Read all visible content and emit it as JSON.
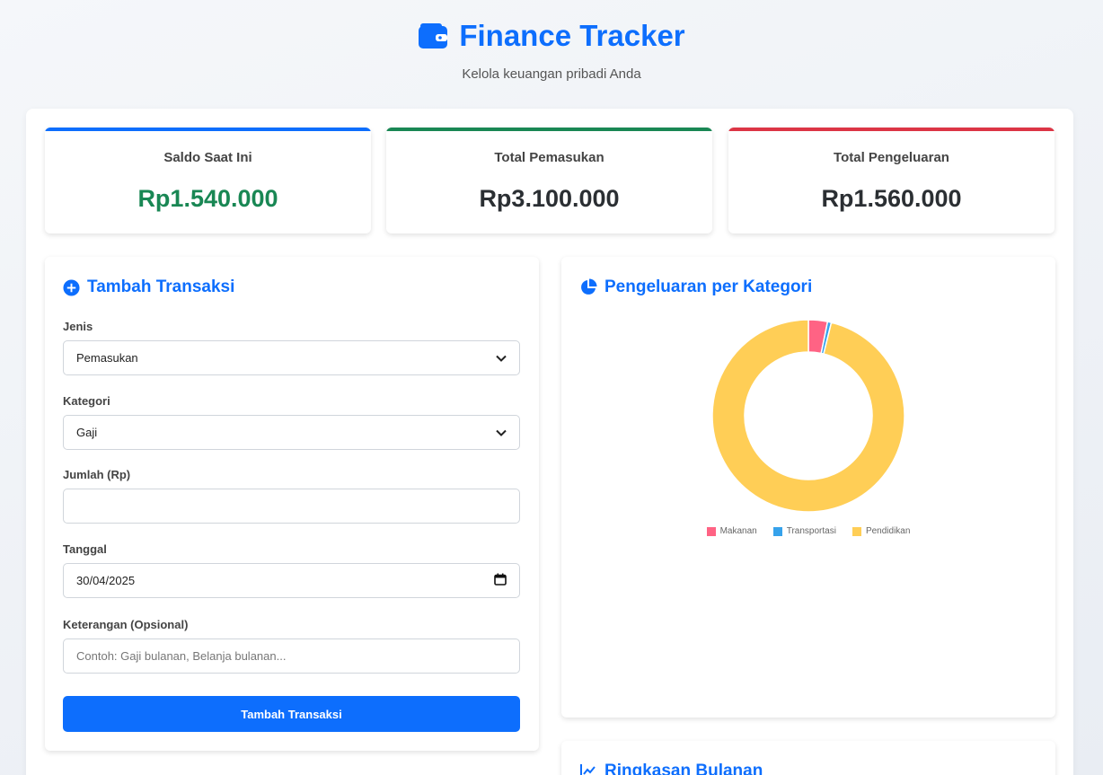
{
  "header": {
    "title": "Finance Tracker",
    "subtitle": "Kelola keuangan pribadi Anda",
    "icon": "wallet-icon"
  },
  "summary": {
    "saldo": {
      "label": "Saldo Saat Ini",
      "value": "Rp1.540.000",
      "accent": "#0d6efd"
    },
    "income": {
      "label": "Total Pemasukan",
      "value": "Rp3.100.000",
      "accent": "#198754"
    },
    "expense": {
      "label": "Total Pengeluaran",
      "value": "Rp1.560.000",
      "accent": "#dc3545"
    }
  },
  "form": {
    "title": "Tambah Transaksi",
    "icon": "plus-circle-icon",
    "jenis": {
      "label": "Jenis",
      "value": "Pemasukan"
    },
    "kategori": {
      "label": "Kategori",
      "value": "Gaji"
    },
    "jumlah": {
      "label": "Jumlah (Rp)",
      "value": ""
    },
    "tanggal": {
      "label": "Tanggal",
      "value": "30/04/2025"
    },
    "keterangan": {
      "label": "Keterangan (Opsional)",
      "placeholder": "Contoh: Gaji bulanan, Belanja bulanan..."
    },
    "submit_label": "Tambah Transaksi"
  },
  "chart_panel": {
    "title": "Pengeluaran per Kategori",
    "icon": "pie-chart-icon"
  },
  "chart_data": {
    "type": "pie",
    "variant": "doughnut",
    "categories": [
      "Makanan",
      "Transportasi",
      "Pendidikan"
    ],
    "values": [
      50000,
      10000,
      1500000
    ],
    "colors": [
      "#ff6384",
      "#36a2eb",
      "#ffce56"
    ],
    "legend": "bottom"
  },
  "summary_panel": {
    "title": "Ringkasan Bulanan",
    "icon": "line-chart-icon"
  }
}
